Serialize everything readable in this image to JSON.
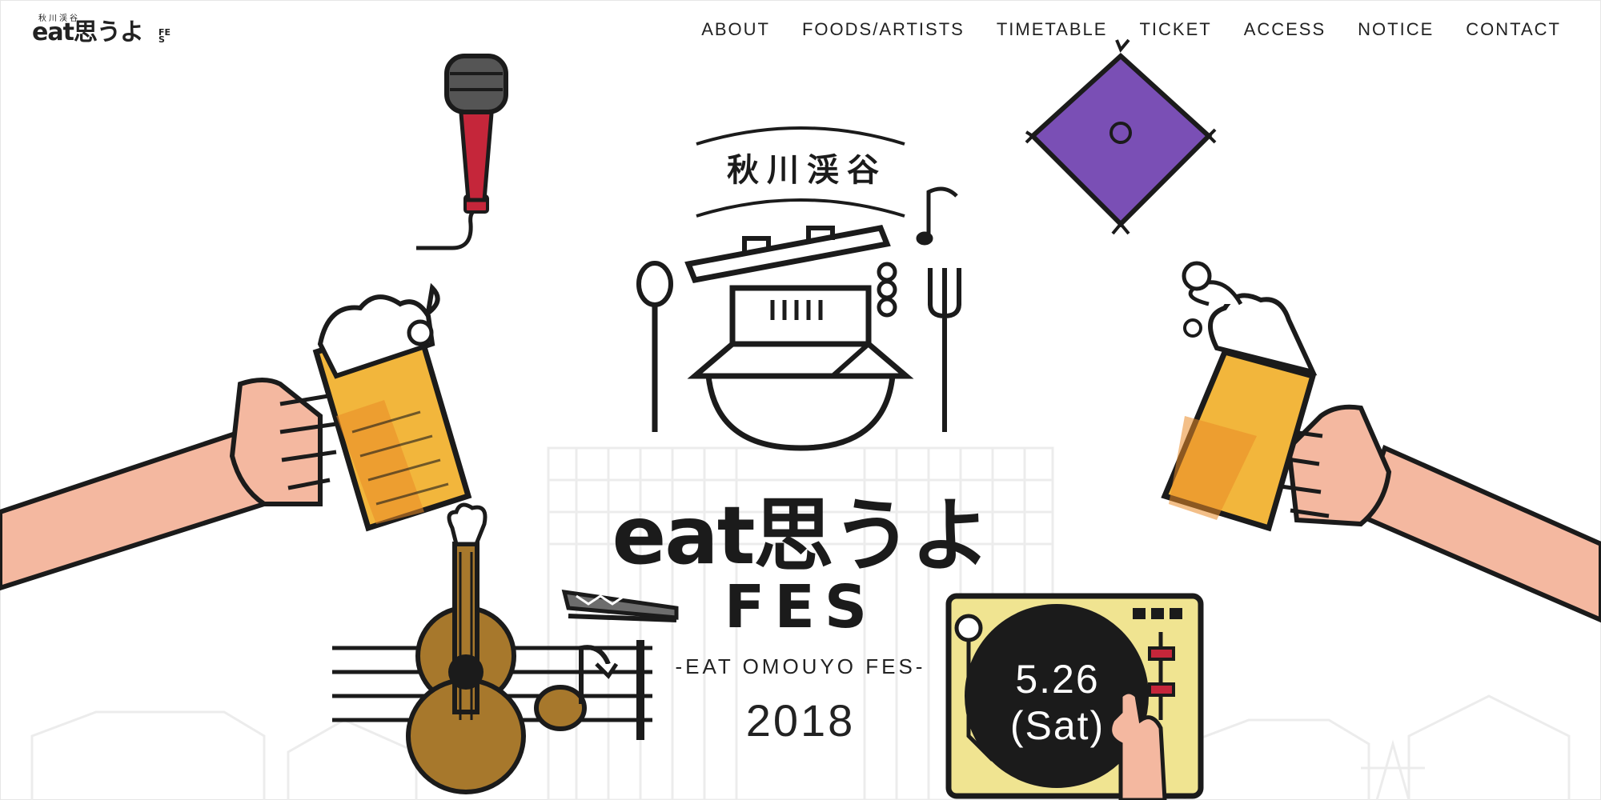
{
  "header": {
    "logo_small": "秋川渓谷",
    "logo_main": "eat思うよ",
    "logo_fes": "FES"
  },
  "nav": [
    {
      "label": "ABOUT"
    },
    {
      "label": "FOODS/ARTISTS"
    },
    {
      "label": "TIMETABLE"
    },
    {
      "label": "TICKET"
    },
    {
      "label": "ACCESS"
    },
    {
      "label": "NOTICE"
    },
    {
      "label": "CONTACT"
    }
  ],
  "hero": {
    "region": "秋川渓谷",
    "title": "eat思うよ",
    "title_fes": "FES",
    "subtitle": "-EAT OMOUYO FES-",
    "year": "2018",
    "date": "5.26",
    "day": "(Sat)"
  },
  "colors": {
    "ink": "#1b1b1b",
    "beer": "#f2b63c",
    "beer_dark": "#e98a27",
    "skin": "#f4b8a0",
    "purple": "#7a4fb5",
    "turntable": "#f0e491",
    "guitar": "#a7782c",
    "mic_red": "#c5263a"
  }
}
